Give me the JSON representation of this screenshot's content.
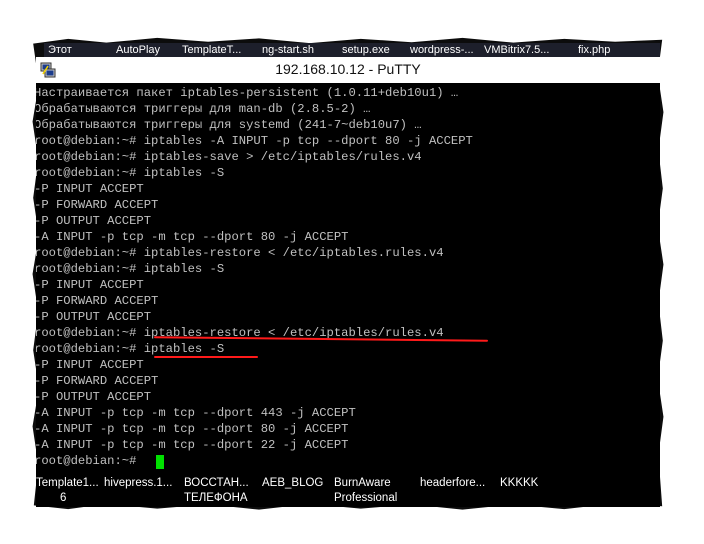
{
  "taskbar_top": {
    "items": [
      "Этот",
      "AutoPlay",
      "TemplateT...",
      "ng-start.sh",
      "setup.exe",
      "wordpress-...",
      "VMBitrix7.5...",
      "fix.php"
    ]
  },
  "window": {
    "title": "192.168.10.12 - PuTTY"
  },
  "terminal": {
    "lines": [
      "Настраивается пакет iptables-persistent (1.0.11+deb10u1) …",
      "Обрабатываются триггеры для man-db (2.8.5-2) …",
      "Обрабатываются триггеры для systemd (241-7~deb10u7) …",
      "root@debian:~# iptables -A INPUT -p tcp --dport 80 -j ACCEPT",
      "root@debian:~# iptables-save > /etc/iptables/rules.v4",
      "root@debian:~# iptables -S",
      "-P INPUT ACCEPT",
      "-P FORWARD ACCEPT",
      "-P OUTPUT ACCEPT",
      "-A INPUT -p tcp -m tcp --dport 80 -j ACCEPT",
      "root@debian:~# iptables-restore < /etc/iptables.rules.v4",
      "root@debian:~# iptables -S",
      "-P INPUT ACCEPT",
      "-P FORWARD ACCEPT",
      "-P OUTPUT ACCEPT",
      "root@debian:~# iptables-restore < /etc/iptables/rules.v4",
      "root@debian:~# iptables -S",
      "-P INPUT ACCEPT",
      "-P FORWARD ACCEPT",
      "-P OUTPUT ACCEPT",
      "-A INPUT -p tcp -m tcp --dport 443 -j ACCEPT",
      "-A INPUT -p tcp -m tcp --dport 80 -j ACCEPT",
      "-A INPUT -p tcp -m tcp --dport 22 -j ACCEPT",
      "root@debian:~# "
    ],
    "highlight_color": "#ff1a1a",
    "cursor_color": "#00e000"
  },
  "taskbar_bottom": {
    "items": [
      "Template1...",
      "hivepress.1...",
      "ВОССТАН...",
      "AEB_BLOG",
      "BurnAware",
      "headerfore...",
      "KKKKK"
    ],
    "subitems": [
      "6",
      "ТЕЛЕФОНА",
      "Professional"
    ]
  }
}
